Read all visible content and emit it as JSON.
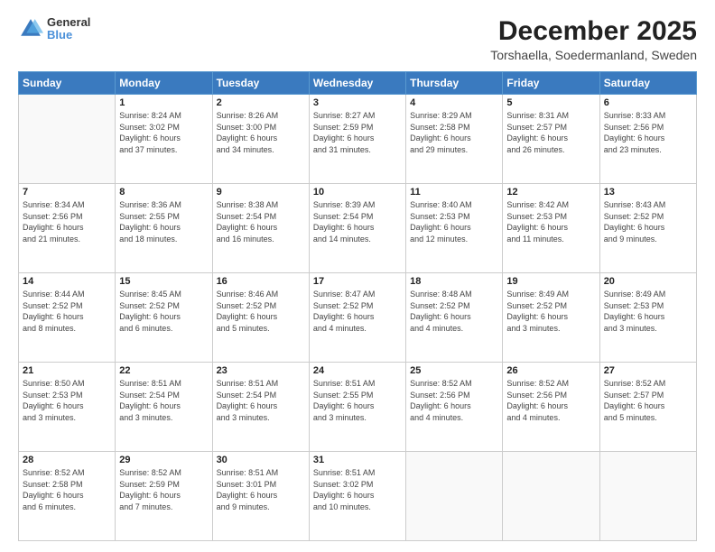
{
  "header": {
    "logo": {
      "line1": "General",
      "line2": "Blue"
    },
    "title": "December 2025",
    "subtitle": "Torshaella, Soedermanland, Sweden"
  },
  "days_of_week": [
    "Sunday",
    "Monday",
    "Tuesday",
    "Wednesday",
    "Thursday",
    "Friday",
    "Saturday"
  ],
  "weeks": [
    [
      {
        "day": "",
        "content": ""
      },
      {
        "day": "1",
        "content": "Sunrise: 8:24 AM\nSunset: 3:02 PM\nDaylight: 6 hours\nand 37 minutes."
      },
      {
        "day": "2",
        "content": "Sunrise: 8:26 AM\nSunset: 3:00 PM\nDaylight: 6 hours\nand 34 minutes."
      },
      {
        "day": "3",
        "content": "Sunrise: 8:27 AM\nSunset: 2:59 PM\nDaylight: 6 hours\nand 31 minutes."
      },
      {
        "day": "4",
        "content": "Sunrise: 8:29 AM\nSunset: 2:58 PM\nDaylight: 6 hours\nand 29 minutes."
      },
      {
        "day": "5",
        "content": "Sunrise: 8:31 AM\nSunset: 2:57 PM\nDaylight: 6 hours\nand 26 minutes."
      },
      {
        "day": "6",
        "content": "Sunrise: 8:33 AM\nSunset: 2:56 PM\nDaylight: 6 hours\nand 23 minutes."
      }
    ],
    [
      {
        "day": "7",
        "content": "Sunrise: 8:34 AM\nSunset: 2:56 PM\nDaylight: 6 hours\nand 21 minutes."
      },
      {
        "day": "8",
        "content": "Sunrise: 8:36 AM\nSunset: 2:55 PM\nDaylight: 6 hours\nand 18 minutes."
      },
      {
        "day": "9",
        "content": "Sunrise: 8:38 AM\nSunset: 2:54 PM\nDaylight: 6 hours\nand 16 minutes."
      },
      {
        "day": "10",
        "content": "Sunrise: 8:39 AM\nSunset: 2:54 PM\nDaylight: 6 hours\nand 14 minutes."
      },
      {
        "day": "11",
        "content": "Sunrise: 8:40 AM\nSunset: 2:53 PM\nDaylight: 6 hours\nand 12 minutes."
      },
      {
        "day": "12",
        "content": "Sunrise: 8:42 AM\nSunset: 2:53 PM\nDaylight: 6 hours\nand 11 minutes."
      },
      {
        "day": "13",
        "content": "Sunrise: 8:43 AM\nSunset: 2:52 PM\nDaylight: 6 hours\nand 9 minutes."
      }
    ],
    [
      {
        "day": "14",
        "content": "Sunrise: 8:44 AM\nSunset: 2:52 PM\nDaylight: 6 hours\nand 8 minutes."
      },
      {
        "day": "15",
        "content": "Sunrise: 8:45 AM\nSunset: 2:52 PM\nDaylight: 6 hours\nand 6 minutes."
      },
      {
        "day": "16",
        "content": "Sunrise: 8:46 AM\nSunset: 2:52 PM\nDaylight: 6 hours\nand 5 minutes."
      },
      {
        "day": "17",
        "content": "Sunrise: 8:47 AM\nSunset: 2:52 PM\nDaylight: 6 hours\nand 4 minutes."
      },
      {
        "day": "18",
        "content": "Sunrise: 8:48 AM\nSunset: 2:52 PM\nDaylight: 6 hours\nand 4 minutes."
      },
      {
        "day": "19",
        "content": "Sunrise: 8:49 AM\nSunset: 2:52 PM\nDaylight: 6 hours\nand 3 minutes."
      },
      {
        "day": "20",
        "content": "Sunrise: 8:49 AM\nSunset: 2:53 PM\nDaylight: 6 hours\nand 3 minutes."
      }
    ],
    [
      {
        "day": "21",
        "content": "Sunrise: 8:50 AM\nSunset: 2:53 PM\nDaylight: 6 hours\nand 3 minutes."
      },
      {
        "day": "22",
        "content": "Sunrise: 8:51 AM\nSunset: 2:54 PM\nDaylight: 6 hours\nand 3 minutes."
      },
      {
        "day": "23",
        "content": "Sunrise: 8:51 AM\nSunset: 2:54 PM\nDaylight: 6 hours\nand 3 minutes."
      },
      {
        "day": "24",
        "content": "Sunrise: 8:51 AM\nSunset: 2:55 PM\nDaylight: 6 hours\nand 3 minutes."
      },
      {
        "day": "25",
        "content": "Sunrise: 8:52 AM\nSunset: 2:56 PM\nDaylight: 6 hours\nand 4 minutes."
      },
      {
        "day": "26",
        "content": "Sunrise: 8:52 AM\nSunset: 2:56 PM\nDaylight: 6 hours\nand 4 minutes."
      },
      {
        "day": "27",
        "content": "Sunrise: 8:52 AM\nSunset: 2:57 PM\nDaylight: 6 hours\nand 5 minutes."
      }
    ],
    [
      {
        "day": "28",
        "content": "Sunrise: 8:52 AM\nSunset: 2:58 PM\nDaylight: 6 hours\nand 6 minutes."
      },
      {
        "day": "29",
        "content": "Sunrise: 8:52 AM\nSunset: 2:59 PM\nDaylight: 6 hours\nand 7 minutes."
      },
      {
        "day": "30",
        "content": "Sunrise: 8:51 AM\nSunset: 3:01 PM\nDaylight: 6 hours\nand 9 minutes."
      },
      {
        "day": "31",
        "content": "Sunrise: 8:51 AM\nSunset: 3:02 PM\nDaylight: 6 hours\nand 10 minutes."
      },
      {
        "day": "",
        "content": ""
      },
      {
        "day": "",
        "content": ""
      },
      {
        "day": "",
        "content": ""
      }
    ]
  ]
}
